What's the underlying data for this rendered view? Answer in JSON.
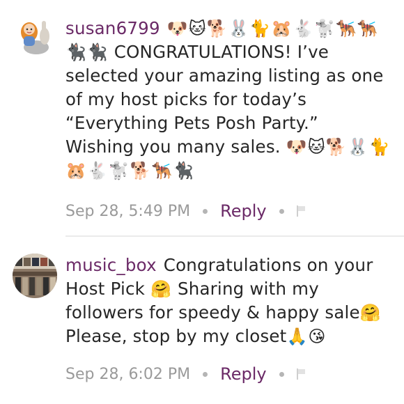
{
  "comments": [
    {
      "username": "susan6799",
      "emojis_lead": "🐶🐱🐕🐰🐈🐹🐇🐩🐕‍🦺🐕‍🦺🐈‍⬛🐈‍⬛",
      "text": "CONGRATULATIONS! I’ve selected your amazing listing as one of my host picks for today’s “Everything Pets Posh Party.” Wishing you many sales.",
      "emojis_tail": "🐶🐱🐕🐰🐈🐹🐇🐩🐕🐕‍🦺🐈‍⬛",
      "timestamp": "Sep 28, 5:49 PM",
      "reply_label": "Reply"
    },
    {
      "username": "music_box",
      "text_1": "Congratulations on your Host Pick",
      "emoji_1": "🤗",
      "text_2": "Sharing with my followers for speedy & happy sale",
      "emoji_2": "🤗",
      "text_3": "Please, stop by my closet",
      "emoji_3": "🙏😘",
      "timestamp": "Sep 28, 6:02 PM",
      "reply_label": "Reply"
    }
  ],
  "icons": {
    "flag": "flag-icon",
    "avatar_1": "cartoon-avatar-icon",
    "avatar_2": "record-shelf-photo"
  },
  "colors": {
    "username": "#6b2a67",
    "reply": "#6b2a67",
    "meta": "#9a9a9a"
  }
}
